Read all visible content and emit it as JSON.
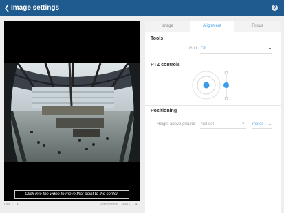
{
  "header": {
    "title": "Image settings",
    "help_symbol": "?"
  },
  "video": {
    "hint": "Click into the video to move that point to the center."
  },
  "footer_left": {
    "left_label": "Live 1",
    "right_label": "Videoformat",
    "format_value": "JPEG"
  },
  "tabs": [
    {
      "label": "Image"
    },
    {
      "label": "Alignment"
    },
    {
      "label": "Focus"
    }
  ],
  "tools": {
    "title": "Tools",
    "grid_label": "Grid",
    "grid_value": "Off"
  },
  "ptz": {
    "title": "PTZ controls"
  },
  "positioning": {
    "title": "Positioning",
    "height_label": "Height above ground",
    "height_placeholder": "Not set",
    "clear_symbol": "×",
    "unit_value": "meter"
  },
  "colors": {
    "header_bg": "#1f5b8f",
    "accent": "#3d9be9"
  }
}
